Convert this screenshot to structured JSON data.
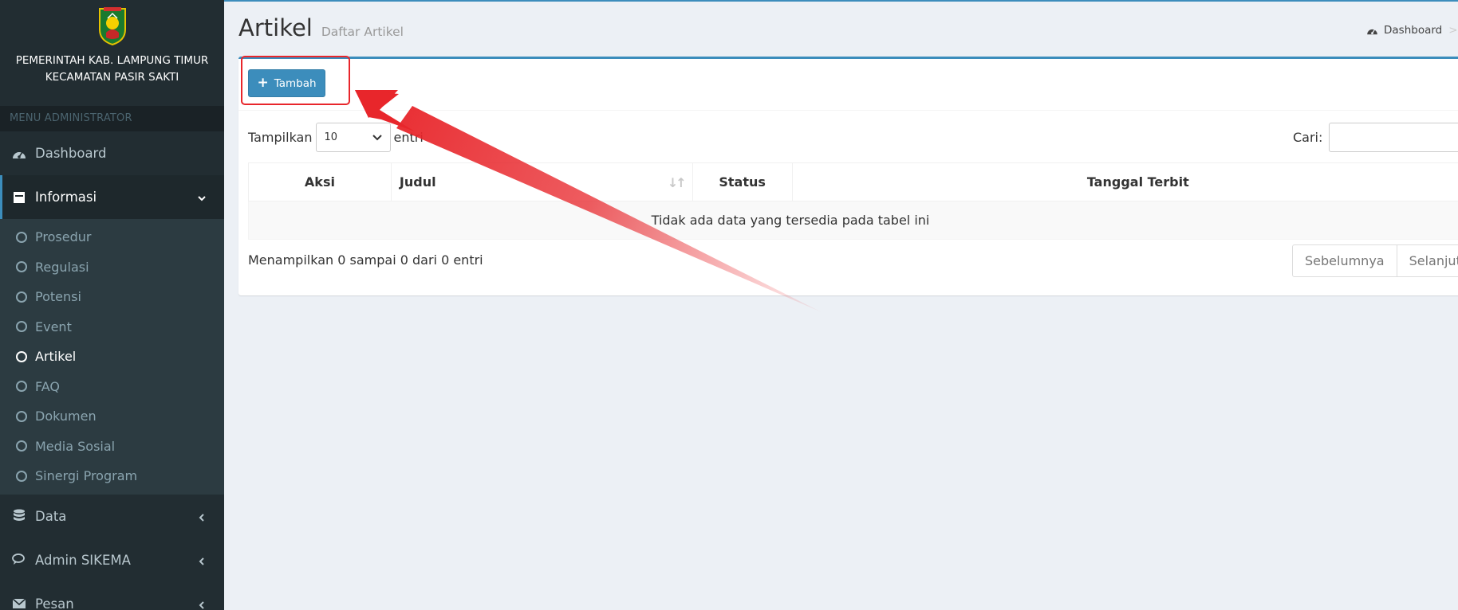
{
  "brand": {
    "line1": "PEMERINTAH KAB. LAMPUNG TIMUR",
    "line2": "KECAMATAN PASIR SAKTI"
  },
  "sidebar": {
    "header": "MENU ADMINISTRATOR",
    "dashboard": "Dashboard",
    "informasi": "Informasi",
    "sub_items": [
      {
        "label": "Prosedur"
      },
      {
        "label": "Regulasi"
      },
      {
        "label": "Potensi"
      },
      {
        "label": "Event"
      },
      {
        "label": "Artikel"
      },
      {
        "label": "FAQ"
      },
      {
        "label": "Dokumen"
      },
      {
        "label": "Media Sosial"
      },
      {
        "label": "Sinergi Program"
      }
    ],
    "data": "Data",
    "admin": "Admin SIKEMA",
    "pesan": "Pesan"
  },
  "header": {
    "title": "Artikel",
    "subtitle": "Daftar Artikel",
    "breadcrumb": "Dashboard",
    "breadcrumb_sep": ">"
  },
  "toolbar": {
    "add_label": "Tambah"
  },
  "table_controls": {
    "show_label": "Tampilkan",
    "length_value": "10",
    "entries_label": "entri",
    "search_label": "Cari:"
  },
  "table": {
    "columns": [
      "Aksi",
      "Judul",
      "Status",
      "Tanggal Terbit"
    ],
    "empty": "Tidak ada data yang tersedia pada tabel ini"
  },
  "footer": {
    "info": "Menampilkan 0 sampai 0 dari 0 entri",
    "prev": "Sebelumnya",
    "next": "Selanjutnya"
  },
  "colors": {
    "accent": "#3c8dbc",
    "sidebar": "#222d32",
    "annotation": "#e8262b"
  }
}
